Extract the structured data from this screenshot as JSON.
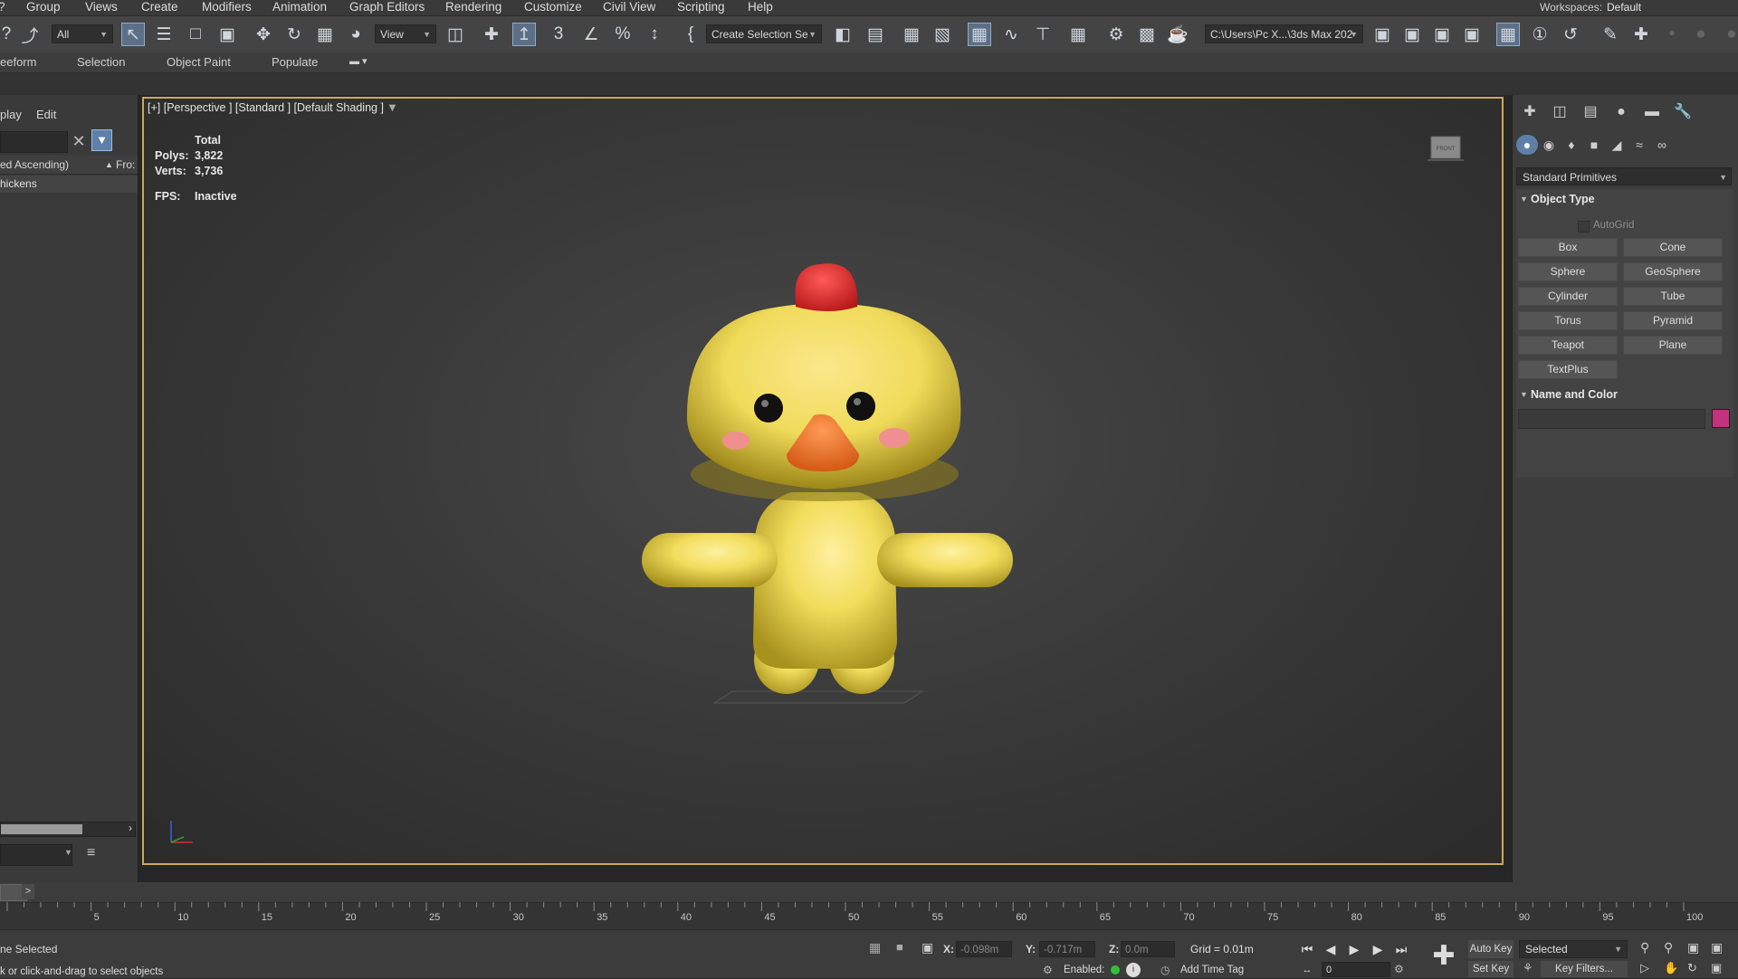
{
  "menu": {
    "items": [
      "Group",
      "Views",
      "Create",
      "Modifiers",
      "Animation",
      "Graph Editors",
      "Rendering",
      "Customize",
      "Civil View",
      "Scripting",
      "Help"
    ],
    "workspace_label": "Workspaces:",
    "workspace_value": "Default"
  },
  "toolbar": {
    "filter_value": "All",
    "ref_coord_value": "View",
    "selection_set_value": "Create Selection Se",
    "project_path": "C:\\Users\\Pc X...\\3ds Max 202"
  },
  "ribbon": {
    "tabs": [
      "eeform",
      "Selection",
      "Object Paint",
      "Populate"
    ]
  },
  "scene_explorer": {
    "menu_display": "play",
    "menu_edit": "Edit",
    "sort_header": "ed Ascending)",
    "frozen_header": "Fro:",
    "row_name": "hickens"
  },
  "viewport": {
    "label": "[+] [Perspective ] [Standard ] [Default Shading ]",
    "stats_total": "Total",
    "polys_label": "Polys:",
    "polys_value": "3,822",
    "verts_label": "Verts:",
    "verts_value": "3,736",
    "fps_label": "FPS:",
    "fps_value": "Inactive",
    "viewcube_face": "FRONT"
  },
  "command_panel": {
    "category_dropdown": "Standard Primitives",
    "object_type_title": "Object Type",
    "autogrid_label": "AutoGrid",
    "primitives": [
      "Box",
      "Cone",
      "Sphere",
      "GeoSphere",
      "Cylinder",
      "Tube",
      "Torus",
      "Pyramid",
      "Teapot",
      "Plane",
      "TextPlus"
    ],
    "name_color_title": "Name and Color",
    "name_value": "",
    "object_color": "#c2327e"
  },
  "timeline": {
    "ticks": [
      5,
      10,
      15,
      20,
      25,
      30,
      35,
      40,
      45,
      50,
      55,
      60,
      65,
      70,
      75,
      80,
      85,
      90,
      95,
      100
    ],
    "next_label": ">"
  },
  "statusbar": {
    "selection_status": "ne Selected",
    "prompt": "k or click-and-drag to select objects",
    "x_label": "X:",
    "x_value": "-0.098m",
    "y_label": "Y:",
    "y_value": "-0.717m",
    "z_label": "Z:",
    "z_value": "0.0m",
    "grid_text": "Grid = 0.01m",
    "enabled_label": "Enabled:",
    "add_time_tag": "Add Time Tag",
    "auto_key": "Auto Key",
    "set_key": "Set Key",
    "selected_dropdown": "Selected",
    "key_filters": "Key Filters...",
    "frame_value": "0"
  },
  "colors": {
    "accent_blue": "#5e80a8",
    "viewport_border": "#c9a95a",
    "chick_yellow": "#f2dd5c",
    "comb_red": "#e02828",
    "beak_orange": "#f27a2c",
    "cheek_pink": "#f08f8f"
  }
}
